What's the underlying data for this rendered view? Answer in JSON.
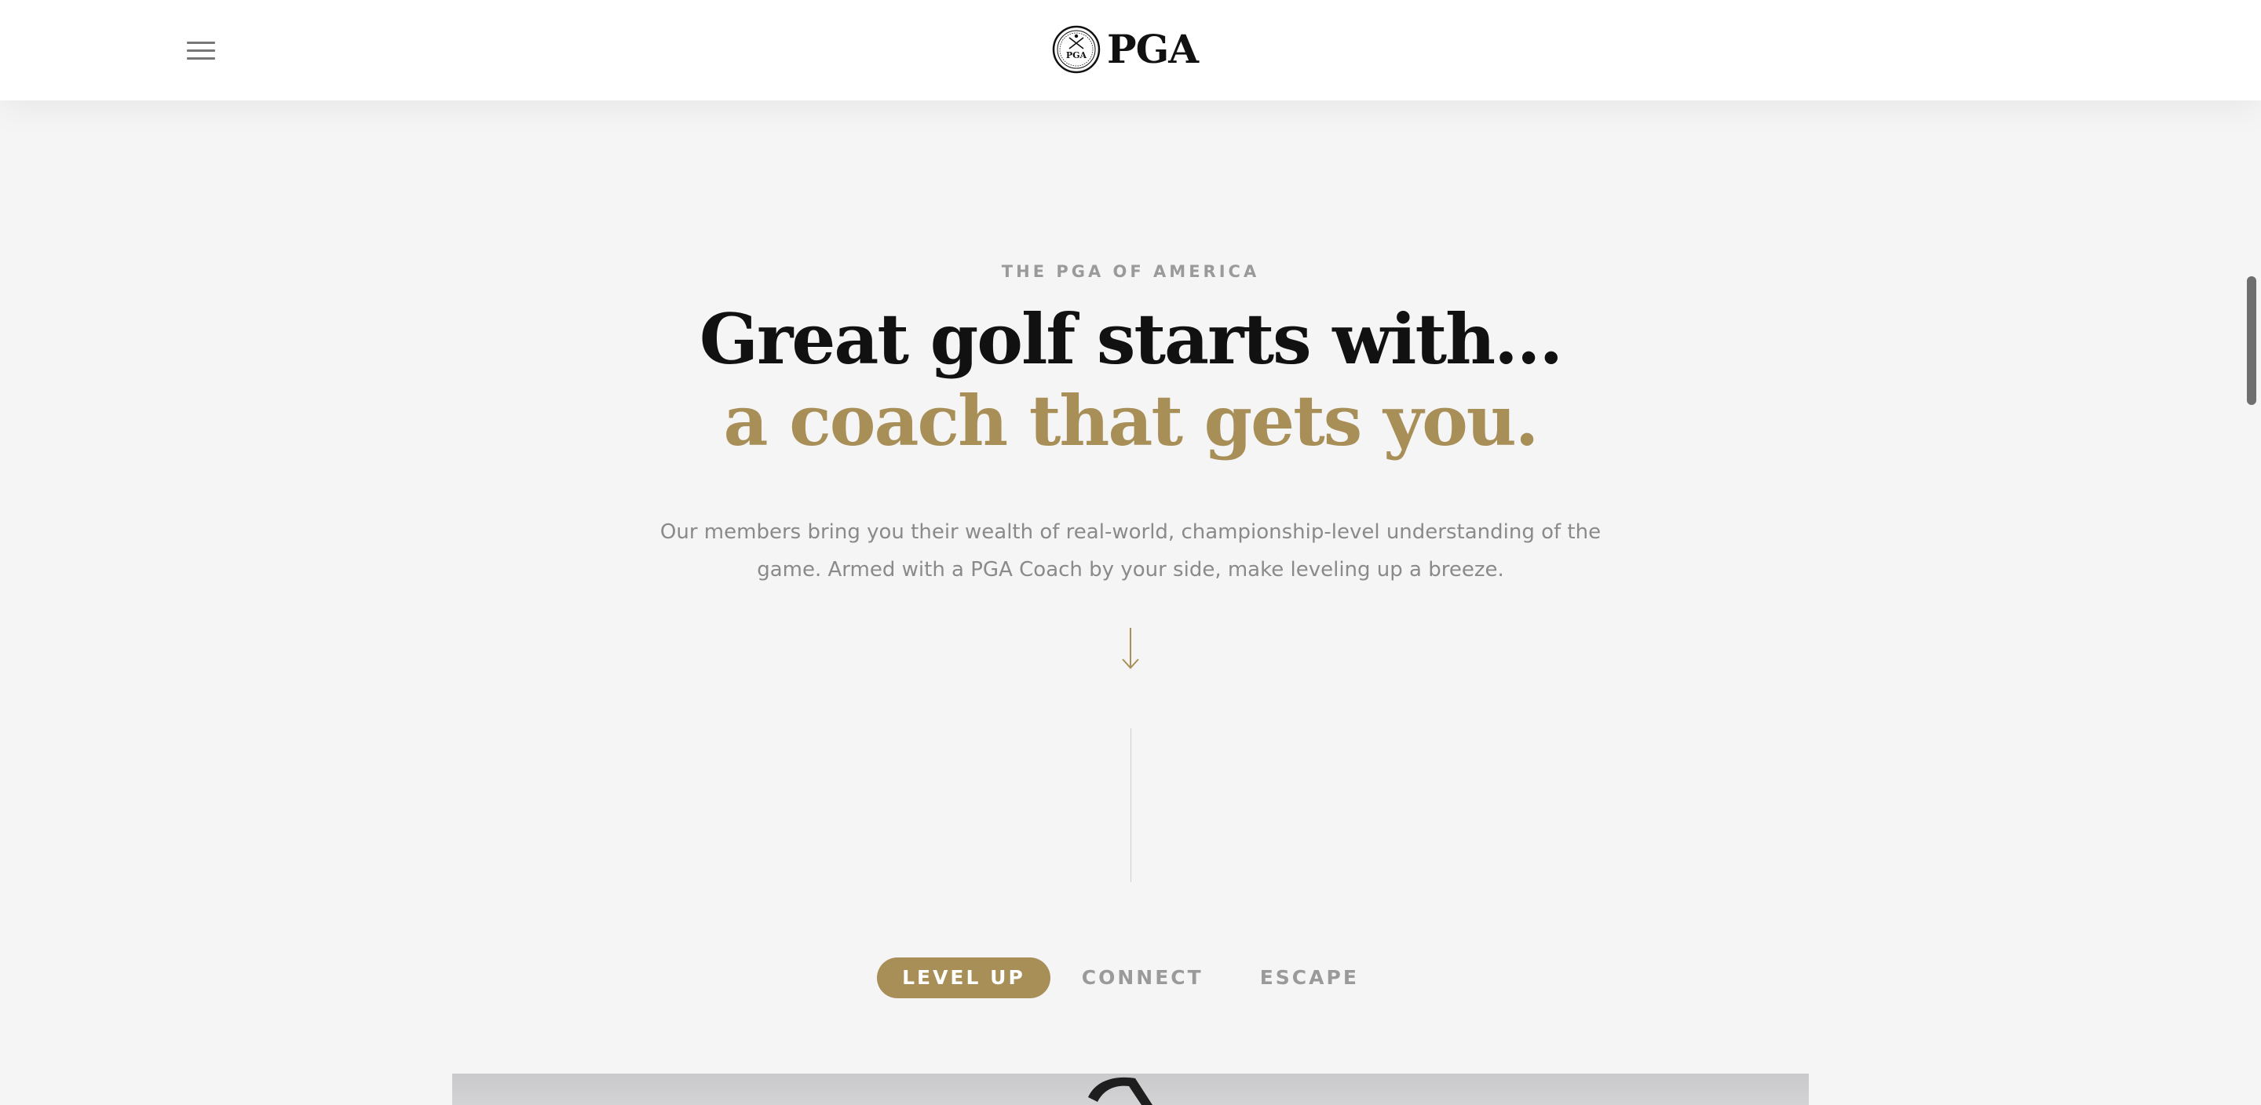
{
  "header": {
    "menu_label": "Menu",
    "logo_alt": "PGA",
    "brand_text": "PGA",
    "seal_text": "PGA"
  },
  "intro": {
    "eyebrow": "THE PGA OF AMERICA",
    "headline_line1": "Great golf starts with…",
    "headline_line2": "a coach that gets you.",
    "body": "Our members bring you their wealth of real-world, championship-level understanding of the game. Armed with a PGA Coach by your side, make leveling up a breeze."
  },
  "tabs": [
    {
      "label": "LEVEL UP",
      "active": true
    },
    {
      "label": "CONNECT",
      "active": false
    },
    {
      "label": "ESCAPE",
      "active": false
    }
  ],
  "colors": {
    "accent_gold": "#a88f57",
    "background": "#f5f5f5",
    "headline": "#111111",
    "muted_text": "#8a8a8a"
  },
  "icons": {
    "menu": "hamburger-icon",
    "scroll": "arrow-down-icon",
    "seal": "pga-seal-logo"
  }
}
